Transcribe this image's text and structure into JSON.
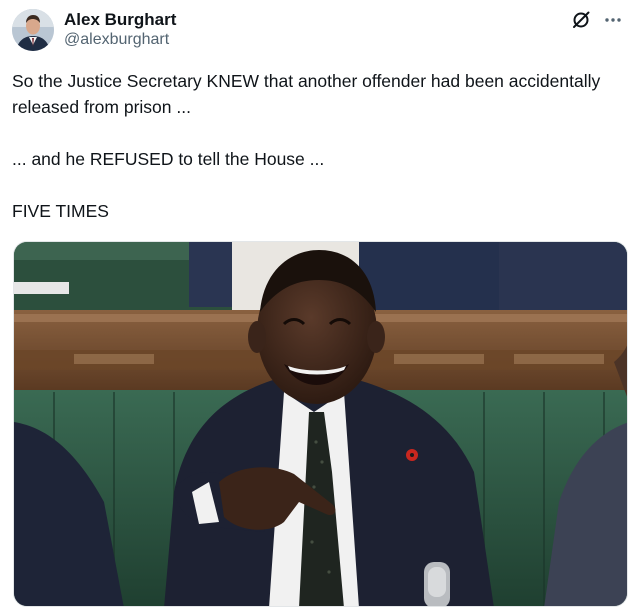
{
  "tweet": {
    "author": {
      "display_name": "Alex Burghart",
      "handle": "@alexburghart",
      "avatar_icon": "user-avatar"
    },
    "paragraphs": [
      "So the Justice Secretary KNEW that another offender had been accidentally released from prison ...",
      "... and he REFUSED to tell the House ...",
      "FIVE TIMES"
    ],
    "icons": {
      "grok": "grok-slash-circle-icon",
      "more": "more-horizontal-icon"
    },
    "media": {
      "type": "photo"
    }
  },
  "colors": {
    "text": "#0f1419",
    "secondary": "#536471",
    "bench_green": "#2f5a45",
    "wood": "#7a5231"
  }
}
